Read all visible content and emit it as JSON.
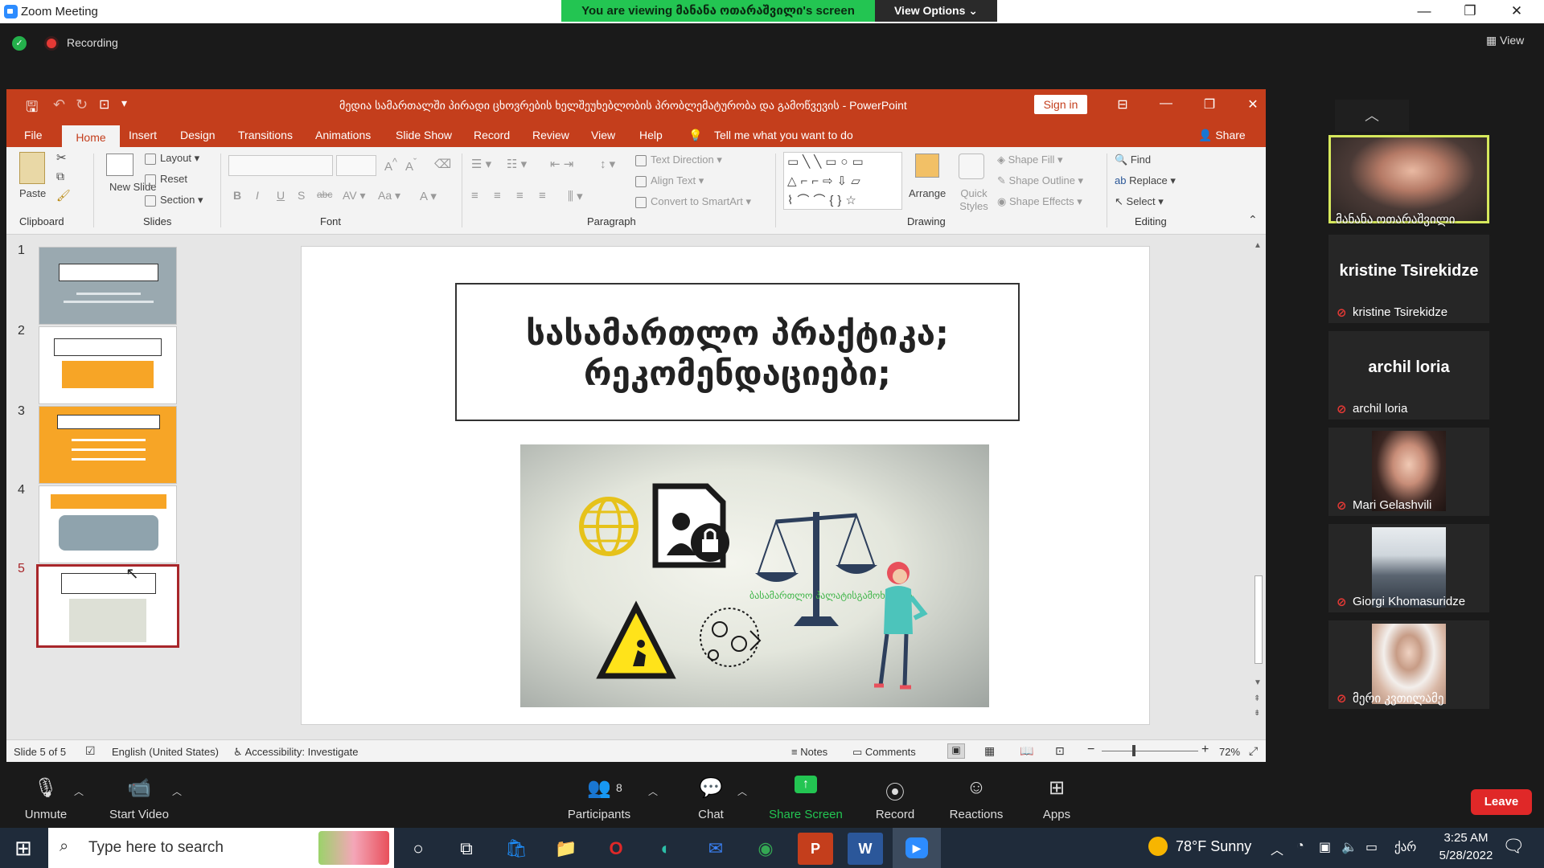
{
  "zoom": {
    "window_title": "Zoom Meeting",
    "banner": "You are viewing მანანა ოთარაშვილი's screen",
    "view_options": "View Options",
    "recording": "Recording",
    "view": "View",
    "leave": "Leave",
    "toolbar": [
      {
        "label": "Unmute",
        "icon": "mic-muted-icon"
      },
      {
        "label": "Start Video",
        "icon": "video-off-icon"
      },
      {
        "label": "Participants",
        "icon": "participants-icon",
        "count": "8"
      },
      {
        "label": "Chat",
        "icon": "chat-icon"
      },
      {
        "label": "Share Screen",
        "icon": "share-screen-icon"
      },
      {
        "label": "Record",
        "icon": "record-icon"
      },
      {
        "label": "Reactions",
        "icon": "reactions-icon"
      },
      {
        "label": "Apps",
        "icon": "apps-icon"
      }
    ],
    "participants": [
      {
        "name": "მანანა ოთარაშვილი",
        "video": true,
        "active_speaker": true
      },
      {
        "name": "kristine Tsirekidze",
        "video": false,
        "muted": true
      },
      {
        "name": "archil loria",
        "video": false,
        "muted": true
      },
      {
        "name": "Mari Gelashvili",
        "video": true,
        "muted": true
      },
      {
        "name": "Giorgi Khomasuridze",
        "video": true,
        "muted": true
      },
      {
        "name": "მერი კვთილამე",
        "video": true,
        "muted": true
      }
    ]
  },
  "ppt": {
    "doc_title": "მედია სამართალში პირადი ცხოვრების ხელშეუხებლობის პრობლემატურობა და გამოწვევის  -  PowerPoint",
    "sign_in": "Sign in",
    "tabs": [
      "File",
      "Home",
      "Insert",
      "Design",
      "Transitions",
      "Animations",
      "Slide Show",
      "Record",
      "Review",
      "View",
      "Help"
    ],
    "active_tab": "Home",
    "tell_me": "Tell me what you want to do",
    "share": "Share",
    "ribbon": {
      "clipboard": {
        "label": "Clipboard",
        "paste": "Paste"
      },
      "slides": {
        "label": "Slides",
        "new_slide": "New Slide",
        "layout": "Layout",
        "reset": "Reset",
        "section": "Section"
      },
      "font": {
        "label": "Font"
      },
      "paragraph": {
        "label": "Paragraph",
        "text_direction": "Text Direction",
        "align_text": "Align Text",
        "convert": "Convert to SmartArt"
      },
      "drawing": {
        "label": "Drawing",
        "arrange": "Arrange",
        "quick_styles": "Quick Styles",
        "shape_fill": "Shape Fill",
        "shape_outline": "Shape Outline",
        "shape_effects": "Shape Effects"
      },
      "editing": {
        "label": "Editing",
        "find": "Find",
        "replace": "Replace",
        "select": "Select"
      }
    },
    "thumbnails": [
      "1",
      "2",
      "3",
      "4",
      "5"
    ],
    "selected_slide": "5",
    "slide": {
      "title_line1": "სასამართლო პრაქტიკა;",
      "title_line2": "რეკომენდაციები;",
      "image_caption": "ბასამართლო პალატისგამოხმარნა"
    },
    "status": {
      "slide_counter": "Slide 5 of 5",
      "language": "English (United States)",
      "accessibility": "Accessibility: Investigate",
      "notes": "Notes",
      "comments": "Comments",
      "zoom": "72%"
    }
  },
  "taskbar": {
    "search_placeholder": "Type here to search",
    "weather": "78°F  Sunny",
    "time": "3:25 AM",
    "date": "5/28/2022",
    "lang": "ქარ"
  },
  "colors": {
    "ppt_red": "#c43e1c",
    "zoom_green": "#23c552",
    "leave_red": "#e02828",
    "thumb_gray": "#9aa9b0",
    "thumb_orange": "#f7a526",
    "selection": "#a8262a"
  }
}
